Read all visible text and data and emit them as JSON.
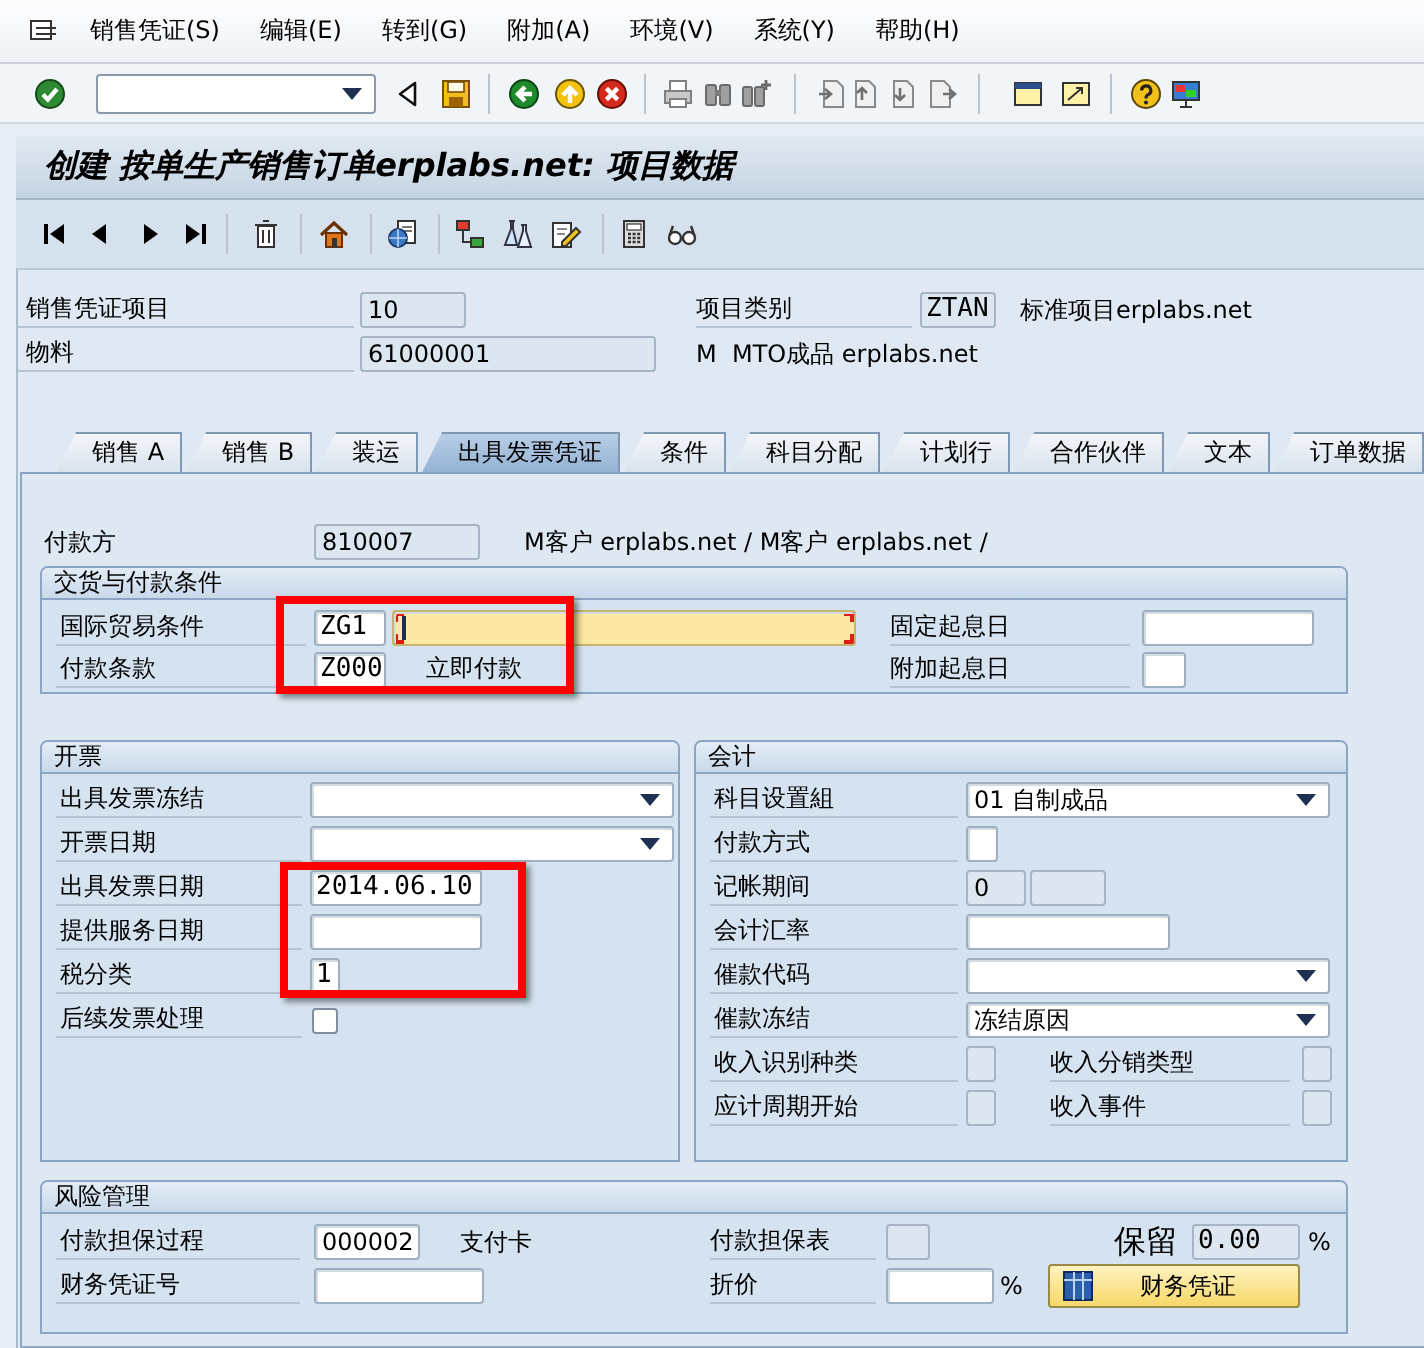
{
  "menu_bar": {
    "items": [
      "销售凭证(S)",
      "编辑(E)",
      "转到(G)",
      "附加(A)",
      "环境(V)",
      "系统(Y)",
      "帮助(H)"
    ]
  },
  "title": "创建 按单生产销售订单erplabs.net: 项目数据",
  "header": {
    "sales_document_item": {
      "label": "销售凭证项目",
      "value": "10"
    },
    "item_category": {
      "label": "项目类别",
      "value": "ZTAN",
      "description": "标准项目erplabs.net"
    },
    "material": {
      "label": "物料",
      "value": "61000001",
      "description": "M  MTO成品 erplabs.net"
    }
  },
  "tabs": [
    {
      "label": "销售 A",
      "selected": false
    },
    {
      "label": "销售 B",
      "selected": false
    },
    {
      "label": "装运",
      "selected": false
    },
    {
      "label": "出具发票凭证",
      "selected": true
    },
    {
      "label": "条件",
      "selected": false
    },
    {
      "label": "科目分配",
      "selected": false
    },
    {
      "label": "计划行",
      "selected": false
    },
    {
      "label": "合作伙伴",
      "selected": false
    },
    {
      "label": "文本",
      "selected": false
    },
    {
      "label": "订单数据",
      "selected": false
    }
  ],
  "payer": {
    "label": "付款方",
    "value": "810007",
    "description": "M客户 erplabs.net / M客户 erplabs.net /"
  },
  "delivery_and_payment": {
    "title": "交货与付款条件",
    "incoterms": {
      "label": "国际贸易条件",
      "value": "ZG1",
      "location": {
        "focused": true
      }
    },
    "fixed_value_date": {
      "label": "固定起息日"
    },
    "payment_terms": {
      "label": "付款条款",
      "value": "Z000",
      "description": "立即付款"
    },
    "additional_value_days": {
      "label": "附加起息日"
    }
  },
  "billing": {
    "title": "开票",
    "rows": [
      {
        "label": "出具发票冻结",
        "kind": "dropdown"
      },
      {
        "label": "开票日期",
        "kind": "dropdown"
      },
      {
        "label": "出具发票日期",
        "kind": "input",
        "value": "2014.06.10"
      },
      {
        "label": "提供服务日期",
        "kind": "input"
      },
      {
        "label": "税分类",
        "kind": "input",
        "value": "1"
      },
      {
        "label": "后续发票处理",
        "kind": "checkbox",
        "checked": false
      }
    ]
  },
  "accounting": {
    "title": "会计",
    "rows": [
      {
        "label": "科目设置組",
        "kind": "dropdown",
        "value": "01 自制成品"
      },
      {
        "label": "付款方式",
        "kind": "input"
      },
      {
        "label": "记帐期间",
        "kind": "period",
        "value": "0"
      },
      {
        "label": "会计汇率",
        "kind": "input"
      },
      {
        "label": "催款代码",
        "kind": "dropdown"
      },
      {
        "label": "催款冻结",
        "kind": "dropdown",
        "value": "冻结原因"
      },
      {
        "label": "收入识别种类",
        "kind": "display",
        "right_label": "收入分销类型"
      },
      {
        "label": "应计周期开始",
        "kind": "display",
        "right_label": "收入事件"
      }
    ]
  },
  "risk_management": {
    "title": "风险管理",
    "guarantee_procedure": {
      "label": "付款担保过程",
      "value": "000002",
      "description": "支付卡"
    },
    "guarantee_form": {
      "label": "付款担保表"
    },
    "retention": {
      "label": "保留",
      "value": "0.00",
      "unit": "%"
    },
    "document_number": {
      "label": "财务凭证号"
    },
    "discount": {
      "label": "折价",
      "unit": "%"
    },
    "button": {
      "label": "财务凭证"
    }
  }
}
